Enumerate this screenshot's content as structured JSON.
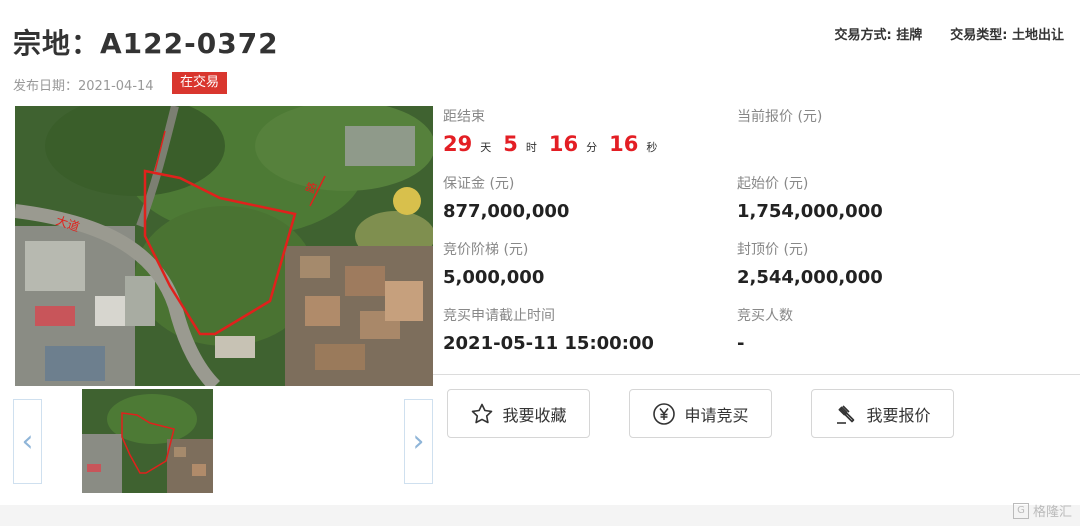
{
  "header": {
    "title": "宗地：A122-0372",
    "trade_method": "交易方式: 挂牌",
    "trade_type": "交易类型: 土地出让",
    "publish_date": "发布日期：2021-04-14",
    "status": "在交易"
  },
  "map": {
    "roads": [
      "大道",
      "路"
    ]
  },
  "info": {
    "countdown_label": "距结束",
    "countdown": {
      "days": "29",
      "days_unit": "天",
      "hours": "5",
      "hours_unit": "时",
      "minutes": "16",
      "minutes_unit": "分",
      "seconds": "16",
      "seconds_unit": "秒"
    },
    "current_price_label": "当前报价 (元)",
    "current_price_value": "",
    "deposit_label": "保证金 (元)",
    "deposit_value": "877,000,000",
    "start_price_label": "起始价 (元)",
    "start_price_value": "1,754,000,000",
    "step_label": "竞价阶梯 (元)",
    "step_value": "5,000,000",
    "cap_price_label": "封顶价 (元)",
    "cap_price_value": "2,544,000,000",
    "deadline_label": "竞买申请截止时间",
    "deadline_value": "2021-05-11 15:00:00",
    "bidders_label": "竞买人数",
    "bidders_value": "-"
  },
  "actions": {
    "favorite": "我要收藏",
    "apply": "申请竞买",
    "bid": "我要报价"
  },
  "watermark": "格隆汇",
  "colors": {
    "accent_red": "#e31e24",
    "badge_red": "#d9362e"
  },
  "icons": [
    "star-icon",
    "yen-circle-icon",
    "gavel-icon",
    "chevron-left-icon",
    "chevron-right-icon"
  ]
}
